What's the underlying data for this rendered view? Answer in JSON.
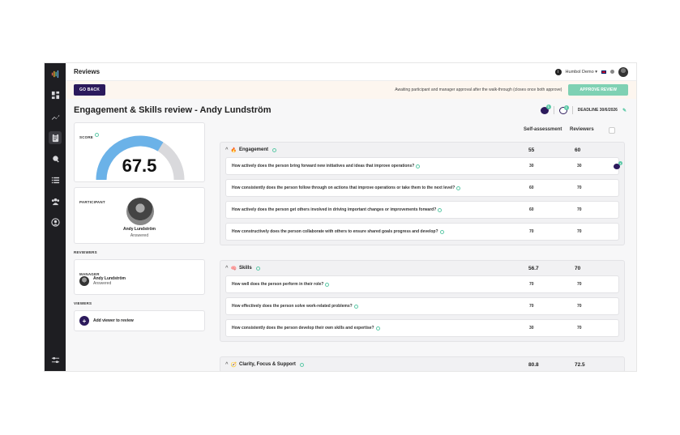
{
  "topbar": {
    "title": "Reviews",
    "org": "Humbol Demo ▾"
  },
  "banner": {
    "go_back": "GO BACK",
    "message": "Awaiting participant and manager approval after the walk-through (closes once both approve)",
    "approve": "APPROVE REVIEW"
  },
  "page": {
    "title": "Engagement & Skills review - Andy Lundström",
    "deadline": "DEADLINE 30/6/2026",
    "comments_badge": "1",
    "history_badge": "1"
  },
  "score": {
    "label": "SCORE",
    "value": "67.5",
    "fraction": 0.675
  },
  "participant": {
    "label": "PARTICIPANT",
    "name": "Andy Lundström",
    "status": "Answered"
  },
  "reviewers": {
    "label": "REVIEWERS",
    "role": "MANAGER",
    "name": "Andy Lundström",
    "status": "Answered"
  },
  "viewers": {
    "label": "VIEWERS",
    "add": "Add viewer to review"
  },
  "columns": {
    "self": "Self-assessment",
    "reviewers": "Reviewers"
  },
  "groups": [
    {
      "title": "Engagement",
      "emoji": "🔥",
      "self": "55",
      "reviewers": "60",
      "questions": [
        {
          "text": "How actively does the person bring forward new initiatives and ideas that improve operations?",
          "self": "30",
          "reviewers": "30",
          "comment_badge": "1"
        },
        {
          "text": "How consistently does the person follow through on actions that improve operations or take them to the next level?",
          "self": "60",
          "reviewers": "70"
        },
        {
          "text": "How actively does the person get others involved in driving important changes or improvements forward?",
          "self": "60",
          "reviewers": "70"
        },
        {
          "text": "How constructively does the person collaborate with others to ensure shared goals progress and develop?",
          "self": "70",
          "reviewers": "70"
        }
      ]
    },
    {
      "title": "Skills",
      "emoji": "🧠",
      "self": "56.7",
      "reviewers": "70",
      "questions": [
        {
          "text": "How well does the person perform in their role?",
          "self": "70",
          "reviewers": "70"
        },
        {
          "text": "How effectively does the person solve work-related problems?",
          "self": "70",
          "reviewers": "70"
        },
        {
          "text": "How consistently does the person develop their own skills and expertise?",
          "self": "30",
          "reviewers": "70"
        }
      ]
    },
    {
      "title": "Clarity, Focus & Support",
      "emoji": "🧭",
      "self": "80.8",
      "reviewers": "72.5",
      "questions": []
    }
  ],
  "colors": {
    "brand": "#2c1a5c",
    "accent": "#5cc9a7",
    "approve": "#7fd1b3",
    "gauge": "#6bb2e8",
    "gauge_track": "#d9d9dc"
  }
}
